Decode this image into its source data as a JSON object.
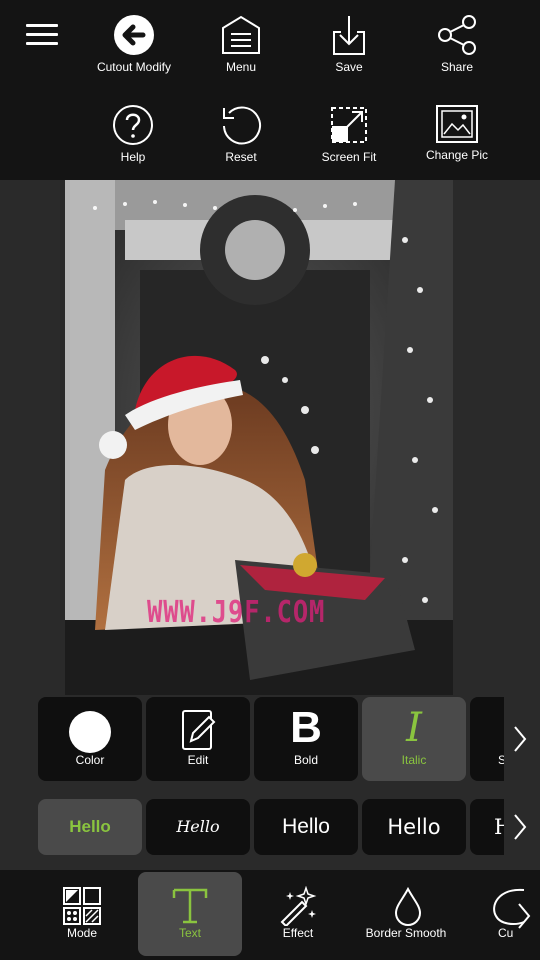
{
  "toolbar": {
    "row1": [
      {
        "label": "Cutout Modify",
        "icon": "back-arrow-icon"
      },
      {
        "label": "Menu",
        "icon": "menu-house-icon"
      },
      {
        "label": "Save",
        "icon": "download-icon"
      },
      {
        "label": "Share",
        "icon": "share-icon"
      }
    ],
    "row2": [
      {
        "label": "Help",
        "icon": "help-icon"
      },
      {
        "label": "Reset",
        "icon": "reset-icon"
      },
      {
        "label": "Screen Fit",
        "icon": "screen-fit-icon"
      },
      {
        "label": "Change Pic",
        "icon": "picture-icon"
      }
    ]
  },
  "canvas": {
    "watermark": "WWW.J9F.COM"
  },
  "text_tools": [
    {
      "label": "Color",
      "icon": "color-circle-icon"
    },
    {
      "label": "Edit",
      "icon": "edit-icon"
    },
    {
      "label": "Bold",
      "icon": "bold-icon"
    },
    {
      "label": "Italic",
      "icon": "italic-icon",
      "active": true
    },
    {
      "label": "S",
      "icon": "partial-icon"
    }
  ],
  "fonts": [
    {
      "label": "Hello",
      "active": true
    },
    {
      "label": "Hello"
    },
    {
      "label": "Hello"
    },
    {
      "label": "Hello"
    },
    {
      "label": "H"
    }
  ],
  "bottom_nav": [
    {
      "label": "Mode",
      "icon": "mode-grid-icon"
    },
    {
      "label": "Text",
      "icon": "text-t-icon",
      "active": true
    },
    {
      "label": "Effect",
      "icon": "magic-wand-icon"
    },
    {
      "label": "Border Smooth",
      "icon": "drop-icon"
    },
    {
      "label": "Cu",
      "icon": "curve-icon"
    }
  ],
  "colors": {
    "accent": "#8ac43f",
    "bar_bg": "#141414",
    "panel_bg": "#2a2a2a",
    "tile_bg": "#0f0f0f",
    "tile_active": "#4a4a4a",
    "watermark": "#e0207a"
  }
}
